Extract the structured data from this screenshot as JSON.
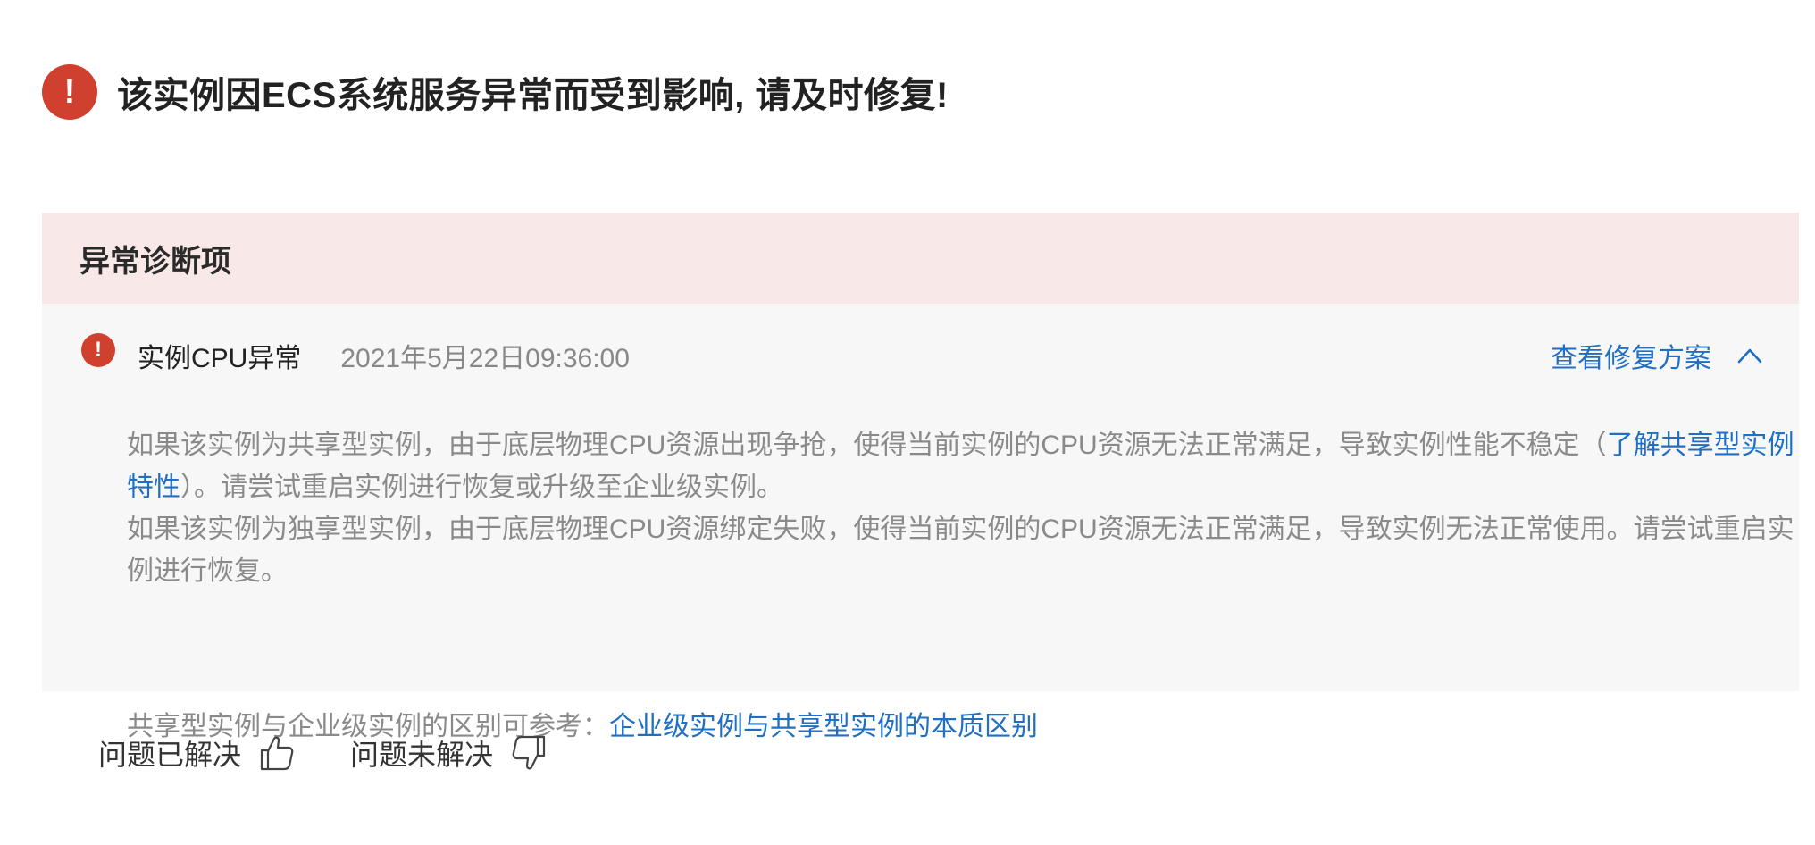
{
  "alert": {
    "icon": "exclamation-circle-icon",
    "title": "该实例因ECS系统服务异常而受到影响, 请及时修复!"
  },
  "diagnosis": {
    "header": "异常诊断项",
    "item": {
      "icon": "exclamation-circle-icon",
      "name": "实例CPU异常",
      "time": "2021年5月22日09:36:00",
      "fix_link": "查看修复方案",
      "expand_icon": "chevron-up-icon"
    },
    "desc": {
      "p1_text": "如果该实例为共享型实例，由于底层物理CPU资源出现争抢，使得当前实例的CPU资源无法正常满足，导致实例性能不稳定（",
      "p1_link": "了解共享型实例特性",
      "p1_tail": "）。请尝试重启实例进行恢复或升级至企业级实例。",
      "p2_text": "如果该实例为独享型实例，由于底层物理CPU资源绑定失败，使得当前实例的CPU资源无法正常满足，导致实例无法正常使用。请尝试重启实例进行恢复。"
    },
    "reference": {
      "label": "共享型实例与企业级实例的区别可参考：",
      "link": "企业级实例与共享型实例的本质区别"
    }
  },
  "feedback": {
    "resolved_label": "问题已解决",
    "resolved_icon": "thumbs-up-icon",
    "unresolved_label": "问题未解决",
    "unresolved_icon": "thumbs-down-icon"
  },
  "colors": {
    "alert_red": "#d0402f",
    "header_bg": "#f8e9e8",
    "body_bg": "#f7f7f7",
    "link_blue": "#1f6fc4"
  }
}
